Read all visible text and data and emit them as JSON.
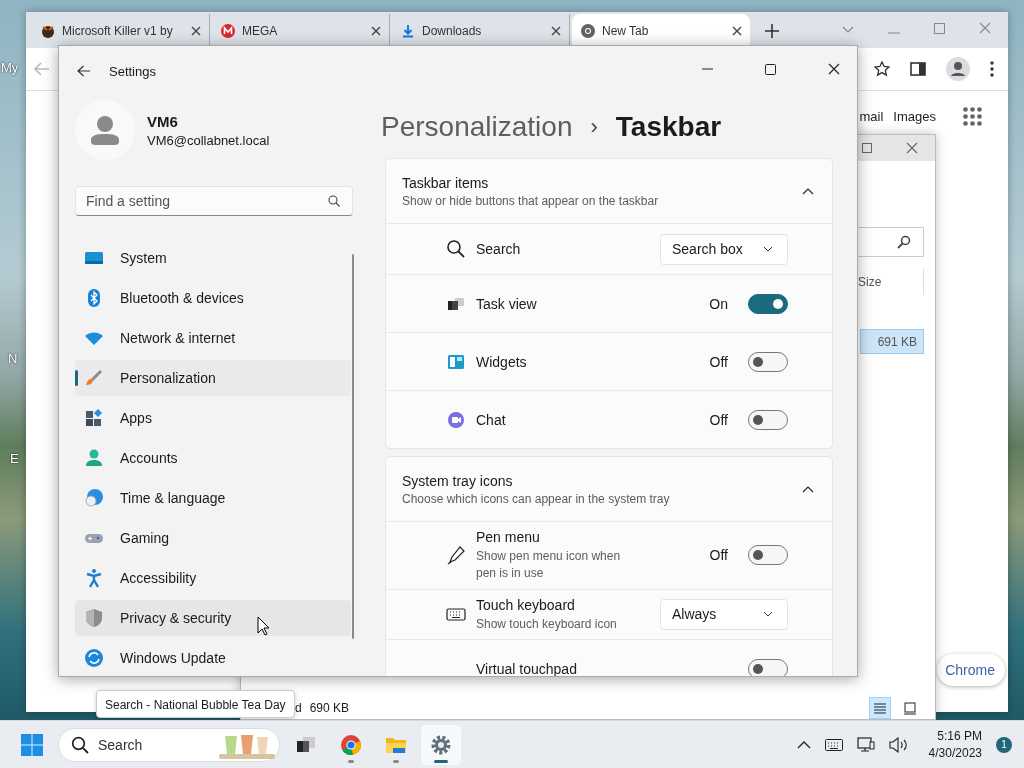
{
  "desktop": {
    "icon_labels": [
      "My",
      "N",
      "E"
    ]
  },
  "browser": {
    "tabs": [
      {
        "title": "Microsoft Killer v1 by",
        "selected": false
      },
      {
        "title": "MEGA",
        "selected": false
      },
      {
        "title": "Downloads",
        "selected": false
      },
      {
        "title": "New Tab",
        "selected": true
      }
    ],
    "page_links": [
      "mail",
      "Images"
    ],
    "page_button": "Chrome"
  },
  "explorer": {
    "column_header": "Size",
    "files": [
      {
        "size": "691 KB",
        "selected": true
      }
    ],
    "status_text": "d",
    "status_size": "690 KB",
    "views": [
      {
        "selected": true
      },
      {
        "selected": false
      }
    ]
  },
  "settings": {
    "title": "Settings",
    "user": {
      "name": "VM6",
      "email": "VM6@collabnet.local"
    },
    "search": {
      "placeholder": "Find a setting"
    },
    "nav": [
      {
        "label": "System",
        "selected": false,
        "hovered": false
      },
      {
        "label": "Bluetooth & devices",
        "selected": false,
        "hovered": false
      },
      {
        "label": "Network & internet",
        "selected": false,
        "hovered": false
      },
      {
        "label": "Personalization",
        "selected": true,
        "hovered": false
      },
      {
        "label": "Apps",
        "selected": false,
        "hovered": false
      },
      {
        "label": "Accounts",
        "selected": false,
        "hovered": false
      },
      {
        "label": "Time & language",
        "selected": false,
        "hovered": false
      },
      {
        "label": "Gaming",
        "selected": false,
        "hovered": false
      },
      {
        "label": "Accessibility",
        "selected": false,
        "hovered": false
      },
      {
        "label": "Privacy & security",
        "selected": false,
        "hovered": true
      },
      {
        "label": "Windows Update",
        "selected": false,
        "hovered": false
      }
    ],
    "breadcrumb": {
      "parent": "Personalization",
      "separator": "›",
      "current": "Taskbar"
    },
    "sections": [
      {
        "title": "Taskbar items",
        "subtitle": "Show or hide buttons that appear on the taskbar",
        "expanded": true,
        "rows": [
          {
            "kind": "dropdown",
            "label": "Search",
            "value": "Search box"
          },
          {
            "kind": "toggle",
            "label": "Task view",
            "on": true,
            "state_label": "On"
          },
          {
            "kind": "toggle",
            "label": "Widgets",
            "on": false,
            "state_label": "Off"
          },
          {
            "kind": "toggle",
            "label": "Chat",
            "on": false,
            "state_label": "Off"
          }
        ]
      },
      {
        "title": "System tray icons",
        "subtitle": "Choose which icons can appear in the system tray",
        "expanded": true,
        "rows": [
          {
            "kind": "toggle",
            "label": "Pen menu",
            "description": "Show pen menu icon when pen is in use",
            "on": false,
            "state_label": "Off"
          },
          {
            "kind": "dropdown",
            "label": "Touch keyboard",
            "description": "Show touch keyboard icon",
            "value": "Always"
          },
          {
            "kind": "toggle",
            "label": "Virtual touchpad",
            "on": false
          }
        ]
      }
    ]
  },
  "taskbar": {
    "search_label": "Search",
    "apps": [
      {
        "running": false,
        "selected": false
      },
      {
        "running": true,
        "selected": false
      },
      {
        "running": true,
        "selected": false
      },
      {
        "running": true,
        "selected": true
      }
    ],
    "time": "5:16 PM",
    "date": "4/30/2023",
    "notification_count": "1"
  },
  "tooltip": "Search - National Bubble Tea Day"
}
